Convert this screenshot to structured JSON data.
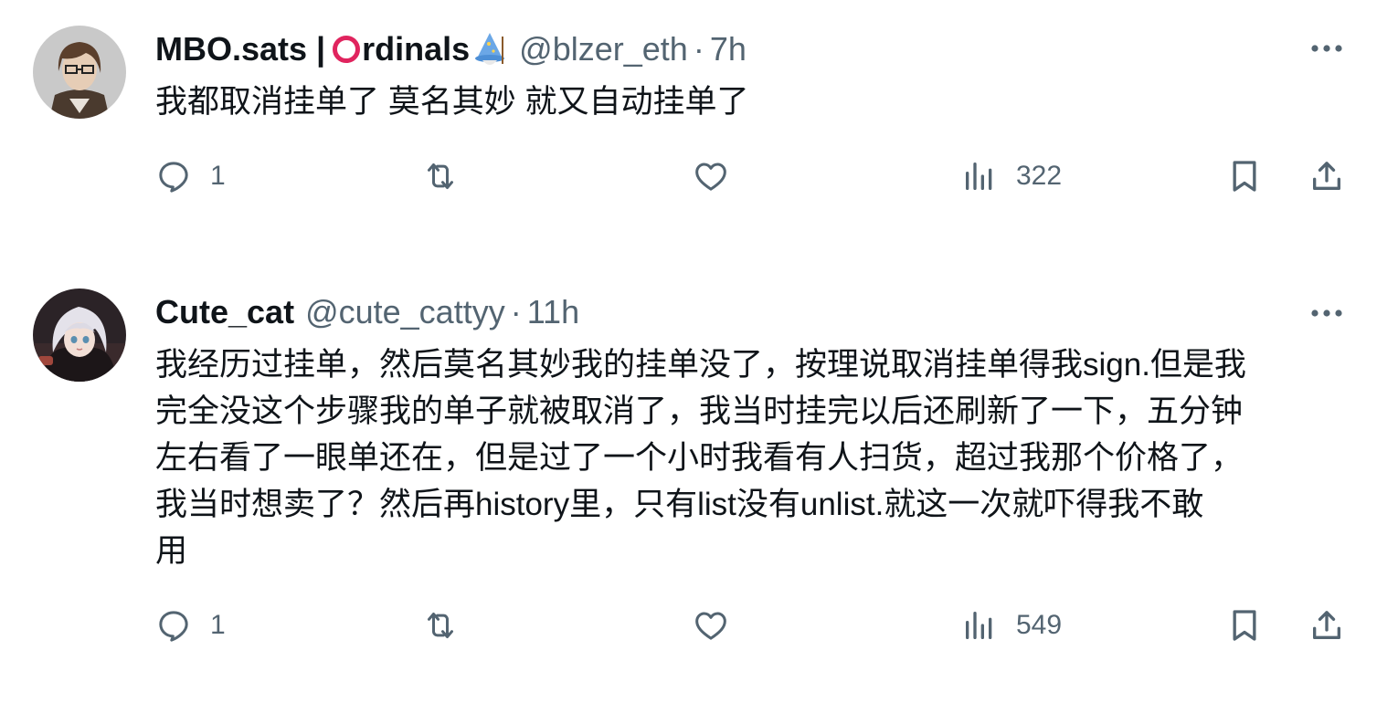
{
  "colors": {
    "text": "#0f1419",
    "secondary": "#536471",
    "ordinals_ring": "#e0245e"
  },
  "tweets": [
    {
      "name_prefix": "MBO.sats | ",
      "name_suffix": "rdinals",
      "name_icons": [
        "red-circle-o-icon",
        "wizard-emoji-icon"
      ],
      "handle": "@blzer_eth",
      "separator": "·",
      "time": "7h",
      "text_lines": [
        "我都取消挂单了 莫名其妙  就又自动挂单了"
      ],
      "replies": "1",
      "views": "322"
    },
    {
      "name_prefix": "Cute_cat",
      "handle": "@cute_cattyy",
      "separator": "·",
      "time": "11h",
      "text_lines": [
        "我经历过挂单，然后莫名其妙我的挂单没了，按理说取消挂单得我sign.但是我",
        "完全没这个步骤我的单子就被取消了，我当时挂完以后还刷新了一下，五分钟",
        "左右看了一眼单还在，但是过了一个小时我看有人扫货，超过我那个价格了，",
        "我当时想卖了？然后再history里，只有list没有unlist.就这一次就吓得我不敢",
        "用"
      ],
      "replies": "1",
      "views": "549"
    }
  ]
}
